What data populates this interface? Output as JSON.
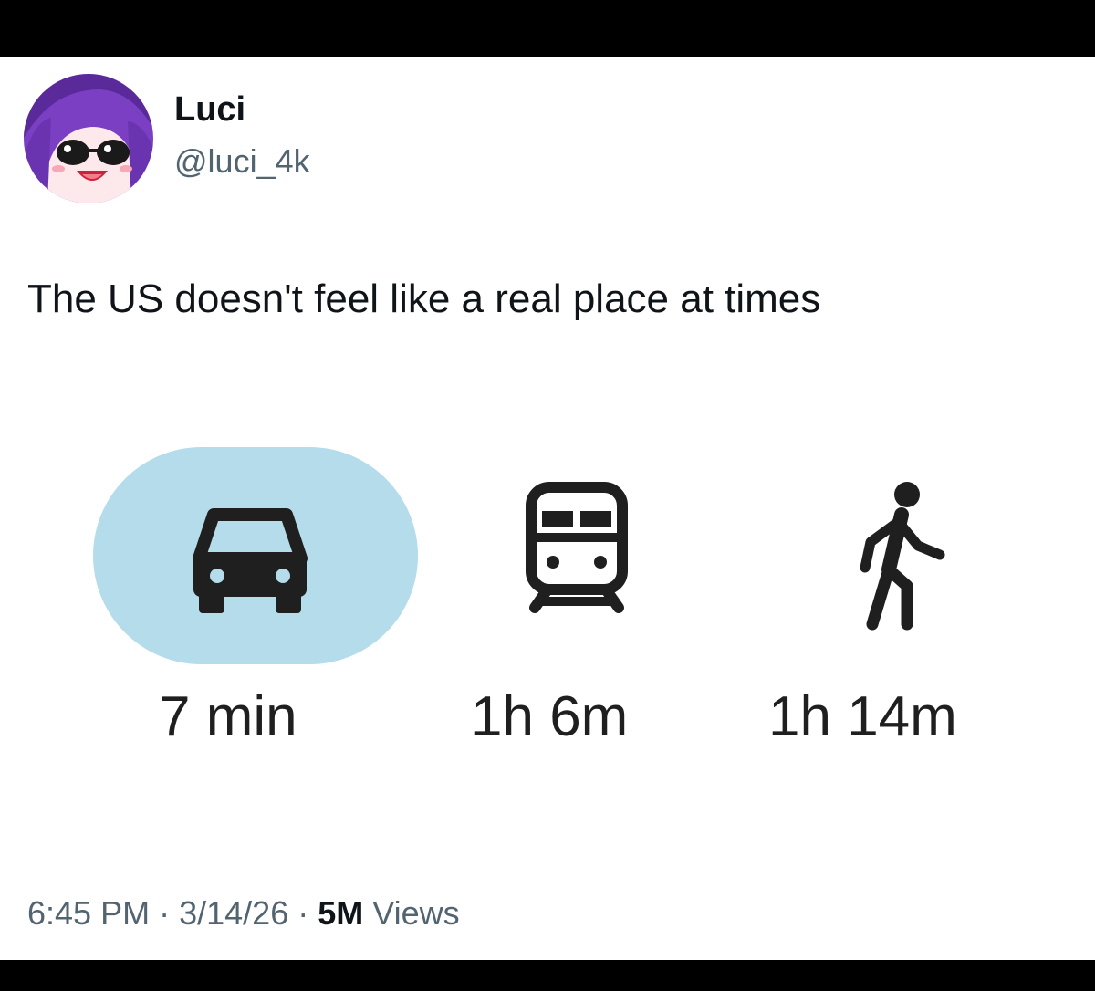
{
  "author": {
    "display_name": "Luci",
    "handle": "@luci_4k"
  },
  "tweet": {
    "text": "The US doesn't feel like a real place at times"
  },
  "travel_modes": [
    {
      "mode": "car",
      "icon": "car-icon",
      "duration": "7 min",
      "selected": true
    },
    {
      "mode": "transit",
      "icon": "train-icon",
      "duration": "1h 6m",
      "selected": false
    },
    {
      "mode": "walk",
      "icon": "walking-person-icon",
      "duration": "1h 14m",
      "selected": false
    }
  ],
  "meta": {
    "time": "6:45 PM",
    "date": "3/14/26",
    "separator": "·",
    "views_count": "5M",
    "views_label": "Views"
  },
  "colors": {
    "selected_mode_bg": "#b5dcea",
    "secondary_text": "#536471",
    "primary_text": "#0f1419",
    "avatar_hair": "#7a3fc2"
  }
}
